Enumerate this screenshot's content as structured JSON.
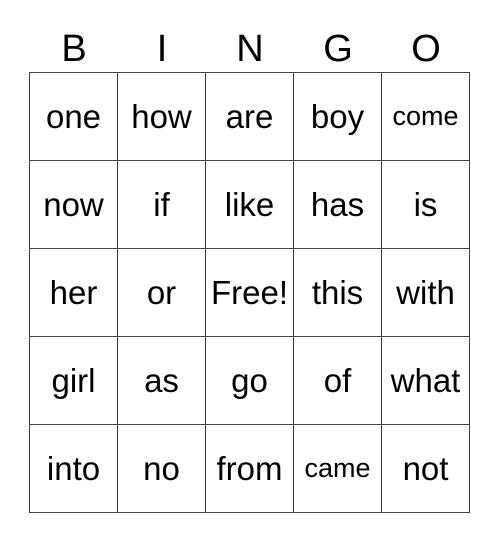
{
  "header": [
    "B",
    "I",
    "N",
    "G",
    "O"
  ],
  "rows": [
    [
      "one",
      "how",
      "are",
      "boy",
      "come"
    ],
    [
      "now",
      "if",
      "like",
      "has",
      "is"
    ],
    [
      "her",
      "or",
      "Free!",
      "this",
      "with"
    ],
    [
      "girl",
      "as",
      "go",
      "of",
      "what"
    ],
    [
      "into",
      "no",
      "from",
      "came",
      "not"
    ]
  ]
}
